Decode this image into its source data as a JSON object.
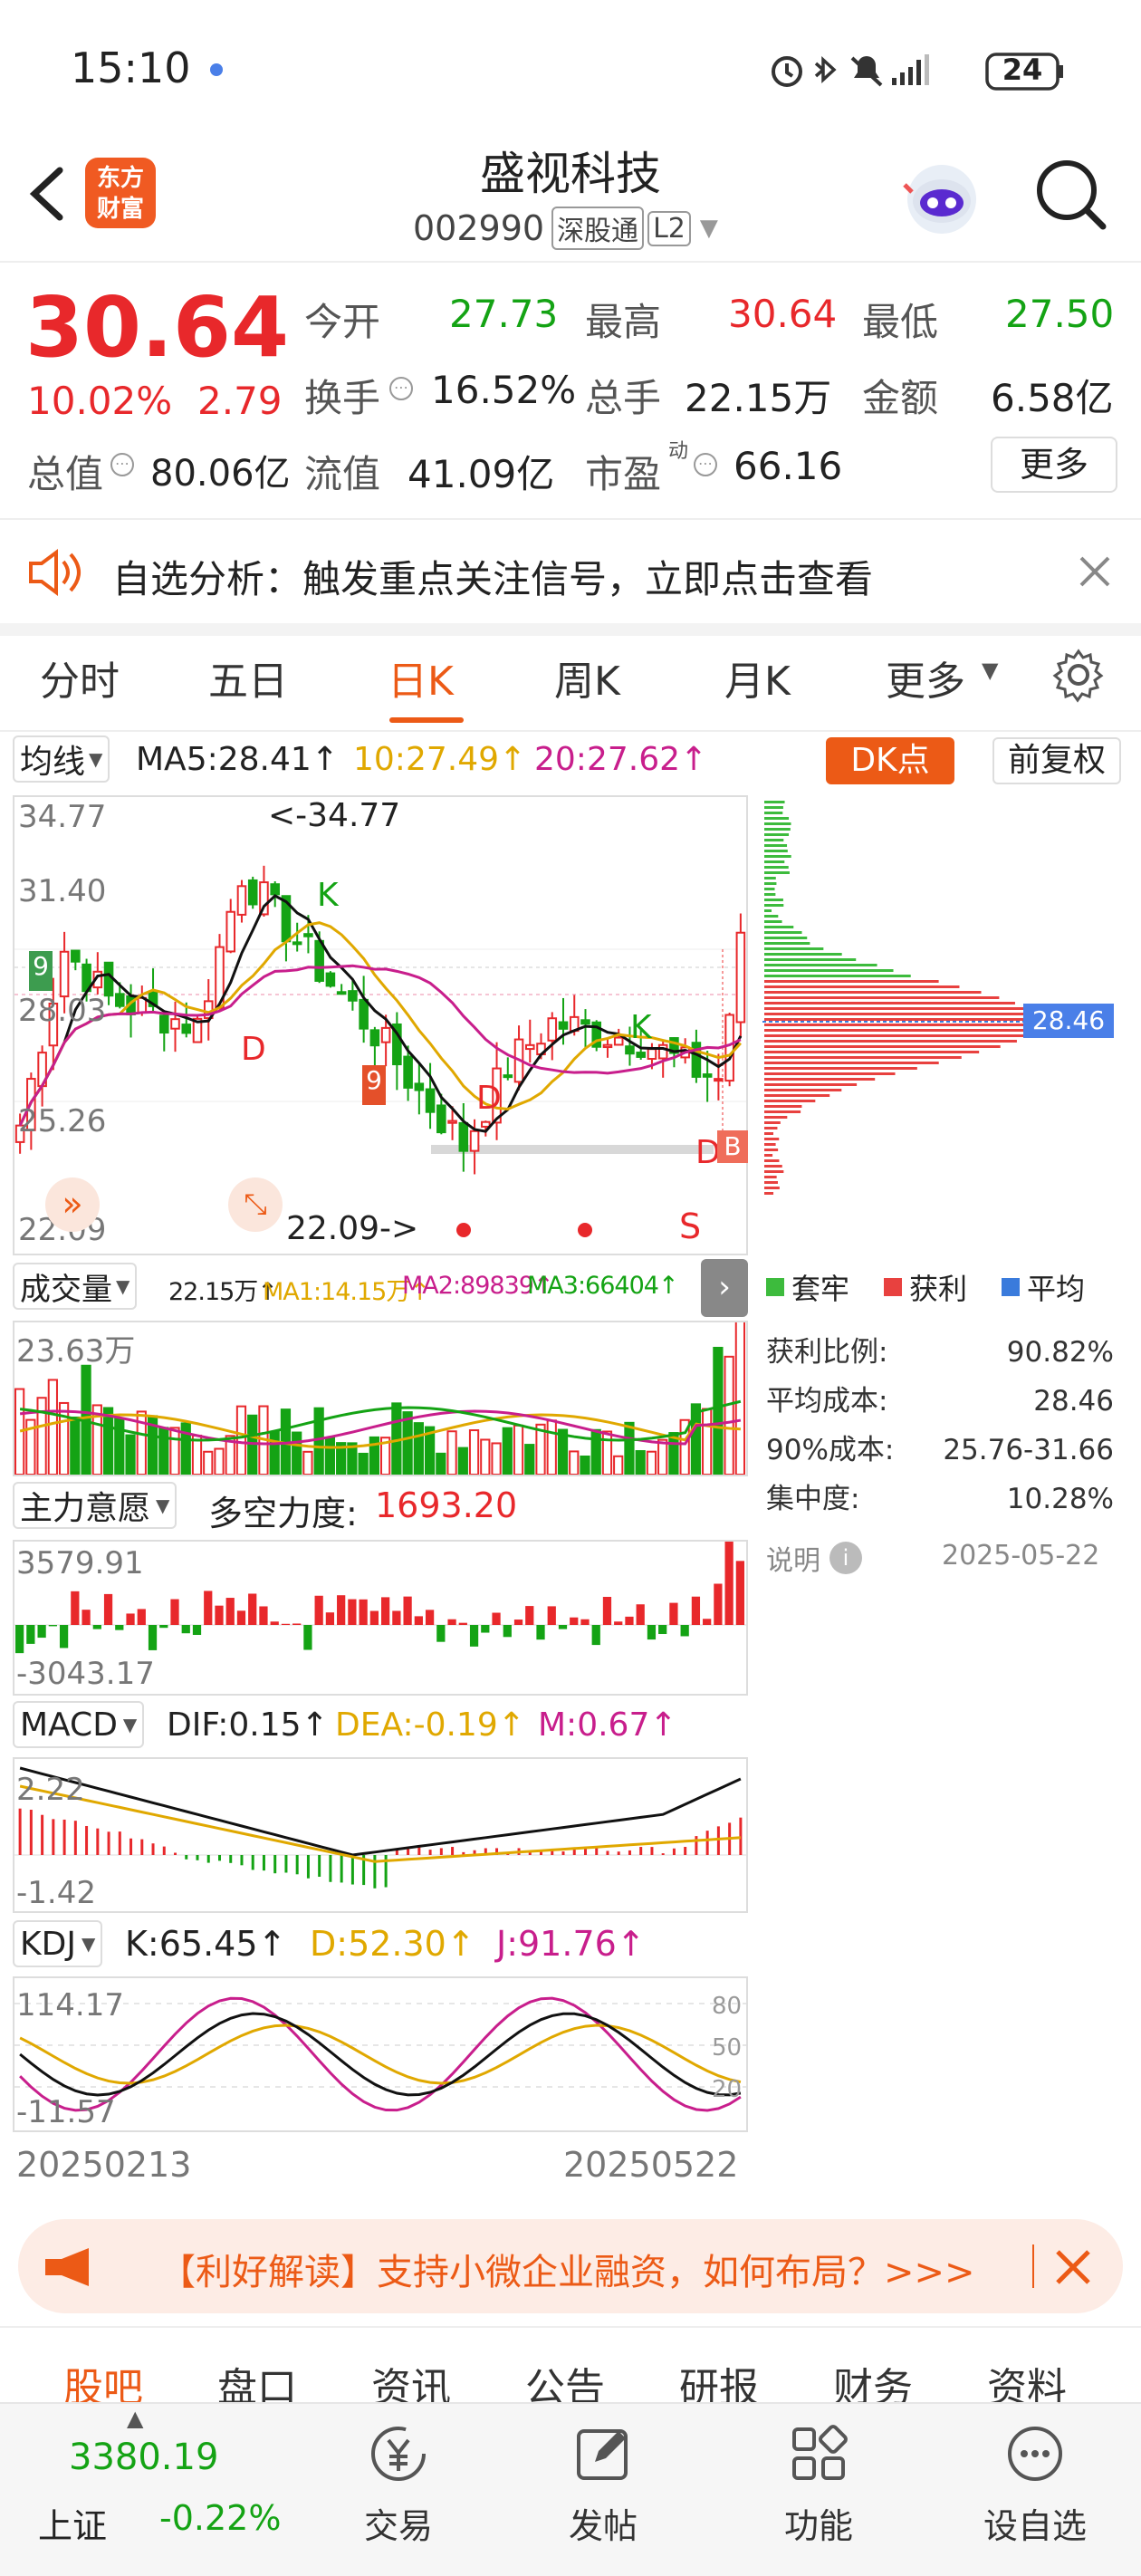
{
  "status": {
    "time": "15:10",
    "battery": "24"
  },
  "header": {
    "title": "盛视科技",
    "code": "002990",
    "badge": "深股通",
    "level": "L2",
    "logo_line1": "东方",
    "logo_line2": "财富"
  },
  "quote": {
    "price": "30.64",
    "change_pct": "10.02%",
    "change": "2.79",
    "open_label": "今开",
    "open": "27.73",
    "high_label": "最高",
    "high": "30.64",
    "low_label": "最低",
    "low": "27.50",
    "turnover_label": "换手",
    "turnover": "16.52%",
    "vol_label": "总手",
    "vol": "22.15万",
    "amount_label": "金额",
    "amount": "6.58亿",
    "mcap_label": "总值",
    "mcap": "80.06亿",
    "float_label": "流值",
    "float": "41.09亿",
    "pe_label": "市盈",
    "pe_sup": "动",
    "pe": "66.16",
    "more": "更多"
  },
  "notice": {
    "text": "自选分析：触发重点关注信号，立即点击查看"
  },
  "tabs": [
    "分时",
    "五日",
    "日K",
    "周K",
    "月K",
    "更多"
  ],
  "ma_bar": {
    "label": "均线",
    "ma5": "MA5:28.41",
    "ma10": "10:27.49",
    "ma20": "20:27.62",
    "dk": "DK点",
    "adj": "前复权"
  },
  "kchart": {
    "y_top": "34.77",
    "y2": "31.40",
    "y3": "28.03",
    "y4": "25.26",
    "y_bot": "22.09",
    "hi_ann": "<-34.77",
    "lo_ann": "22.09->"
  },
  "volume": {
    "label": "成交量",
    "v": "22.15万",
    "ma1": "MA1:14.15万",
    "ma2": "MA2:89839",
    "ma3": "MA3:66404",
    "top": "23.63万"
  },
  "main_force": {
    "label": "主力意愿",
    "title": "多空力度:",
    "value": "1693.20",
    "top": "3579.91",
    "bot": "-3043.17"
  },
  "macd": {
    "label": "MACD",
    "dif": "DIF:0.15",
    "dea": "DEA:-0.19",
    "m": "M:0.67",
    "top": "2.22",
    "bot": "-1.42"
  },
  "kdj": {
    "label": "KDJ",
    "k": "K:65.45",
    "d": "D:52.30",
    "j": "J:91.76",
    "top": "114.17",
    "bot": "-11.57",
    "l80": "80",
    "l50": "50",
    "l20": "20"
  },
  "dates": {
    "start": "20250213",
    "end": "20250522"
  },
  "chip": {
    "legend": [
      "套牢",
      "获利",
      "平均"
    ],
    "avg_tag": "28.46",
    "rows": [
      {
        "k": "获利比例:",
        "v": "90.82%"
      },
      {
        "k": "平均成本:",
        "v": "28.46"
      },
      {
        "k": "90%成本:",
        "v": "25.76-31.66"
      },
      {
        "k": "集中度:",
        "v": "10.28%"
      }
    ],
    "note": "说明",
    "date": "2025-05-22"
  },
  "banner": {
    "text": "【利好解读】支持小微企业融资，如何布局？>>>"
  },
  "bottom_tabs": [
    "股吧",
    "盘口",
    "资讯",
    "公告",
    "研报",
    "财务",
    "资料"
  ],
  "index": {
    "value": "3380.19",
    "name": "上证",
    "change": "-0.22%"
  },
  "bottom_nav": [
    "交易",
    "发帖",
    "功能",
    "设自选"
  ],
  "colors": {
    "up": "#e8282b",
    "down": "#14a314",
    "accent": "#ec5a16"
  }
}
